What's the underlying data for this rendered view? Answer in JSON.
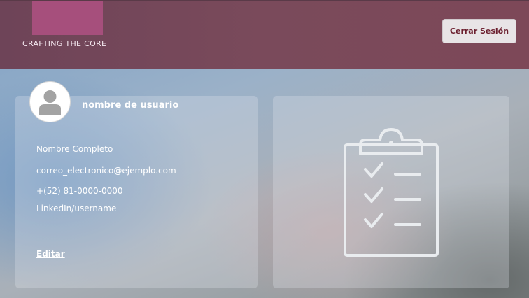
{
  "header": {
    "brand": "CRAFTING THE CORE",
    "logout_label": "Cerrar Sesión"
  },
  "profile": {
    "username": "nombre de usuario",
    "full_name": "Nombre Completo",
    "email": "correo_electronico@ejemplo.com",
    "phone": "+(52) 81-0000-0000",
    "linkedin": "LinkedIn/username",
    "edit_label": "Editar"
  },
  "icons": {
    "avatar": "user-avatar-icon",
    "clipboard": "clipboard-checklist-icon"
  },
  "colors": {
    "header": "#7a4a5b",
    "logo": "#a64f7c",
    "logout_text": "#6b1e2e"
  }
}
